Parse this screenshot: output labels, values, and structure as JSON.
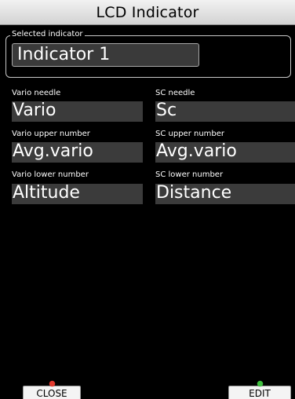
{
  "window": {
    "title": "LCD Indicator"
  },
  "selected_indicator": {
    "label": "Selected indicator",
    "value": "Indicator 1"
  },
  "fields": {
    "vario_needle": {
      "label": "Vario needle",
      "value": "Vario"
    },
    "sc_needle": {
      "label": "SC needle",
      "value": "Sc"
    },
    "vario_upper": {
      "label": "Vario upper number",
      "value": "Avg.vario"
    },
    "sc_upper": {
      "label": "SC upper number",
      "value": "Avg.vario"
    },
    "vario_lower": {
      "label": "Vario lower number",
      "value": "Altitude"
    },
    "sc_lower": {
      "label": "SC lower number",
      "value": "Distance"
    }
  },
  "buttons": {
    "close": {
      "label": "CLOSE",
      "indicator_color": "#e23a2e"
    },
    "edit": {
      "label": "EDIT",
      "indicator_color": "#3fbf3f"
    }
  }
}
